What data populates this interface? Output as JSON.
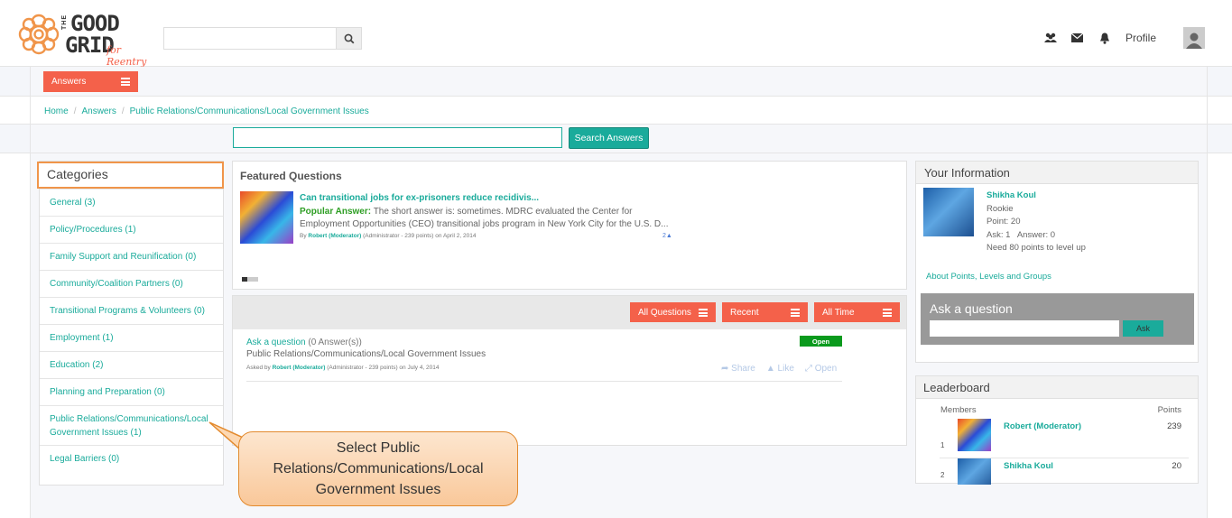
{
  "header": {
    "logo_top": "THE",
    "logo_good": "GOOD",
    "logo_grid": "GRID",
    "logo_tag": "for Reentry",
    "search_placeholder": "",
    "icons": [
      "users-icon",
      "envelope-icon",
      "bell-icon"
    ],
    "profile_label": "Profile"
  },
  "nav": {
    "answers_label": "Answers"
  },
  "breadcrumb": {
    "items": [
      "Home",
      "Answers",
      "Public Relations/Communications/Local Government Issues"
    ]
  },
  "search": {
    "value": "",
    "button_label": "Search Answers"
  },
  "categories": {
    "title": "Categories",
    "items": [
      "General (3)",
      "Policy/Procedures (1)",
      "Family Support and Reunification (0)",
      "Community/Coalition Partners (0)",
      "Transitional Programs & Volunteers (0)",
      "Employment (1)",
      "Education (2)",
      "Planning and Preparation (0)",
      "Public Relations/Communications/Local Government Issues (1)",
      "Legal Barriers (0)"
    ]
  },
  "featured": {
    "title": "Featured Questions",
    "question": "Can transitional jobs for ex-prisoners reduce recidivis...",
    "popular_label": "Popular Answer:",
    "answer": "The short answer is: sometimes. MDRC evaluated the Center for Employment Opportunities (CEO) transitional jobs program in New York City for the U.S. D...",
    "meta_by": "By",
    "meta_author": "Robert (Moderator)",
    "meta_rest": "(Administrator - 239 points)  on April 2, 2014",
    "likes": "2"
  },
  "questions": {
    "filters": [
      "All Questions",
      "Recent",
      "All Time"
    ],
    "item": {
      "title": "Ask a question",
      "answers": "(0 Answer(s))",
      "category": "Public Relations/Communications/Local Government Issues",
      "meta_by": "Asked by",
      "meta_author": "Robert (Moderator)",
      "meta_rest": "(Administrator - 239 points) on July 4, 2014",
      "status": "Open",
      "actions": [
        "Share",
        "Like",
        "Open"
      ]
    }
  },
  "info": {
    "title": "Your Information",
    "name": "Shikha Koul",
    "rank": "Rookie",
    "points": "Point: 20",
    "ask": "Ask: 1",
    "answer": "Answer: 0",
    "need": "Need 80 points to level up",
    "link": "About Points, Levels and Groups",
    "ask_title": "Ask a question",
    "ask_button": "Ask"
  },
  "leaderboard": {
    "title": "Leaderboard",
    "col_members": "Members",
    "col_points": "Points",
    "rows": [
      {
        "rank": "1",
        "name": "Robert (Moderator)",
        "points": "239"
      },
      {
        "rank": "2",
        "name": "Shikha Koul",
        "points": "20"
      }
    ]
  },
  "callout": {
    "text": "Select Public Relations/Communications/Local Government Issues"
  },
  "colors": {
    "accent": "#1aab9b",
    "button": "#f4614a",
    "callout_border": "#e38a2d",
    "open": "#0a9a1d"
  }
}
